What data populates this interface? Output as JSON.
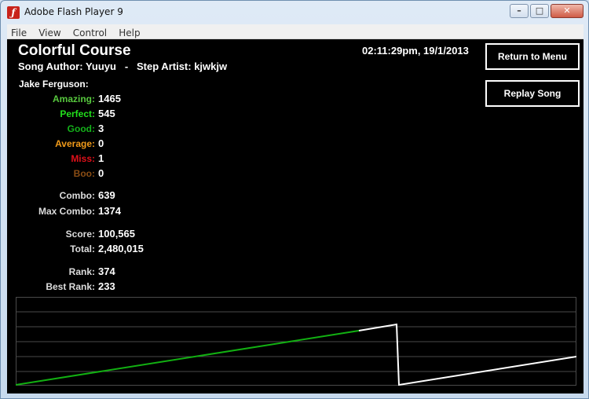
{
  "window": {
    "title": "Adobe Flash Player 9",
    "icon": "flash-player-icon"
  },
  "menu": [
    "File",
    "View",
    "Control",
    "Help"
  ],
  "header": {
    "song_title": "Colorful Course",
    "song_author_label": "Song Author:",
    "song_author": "Yuuyu",
    "separator": "-",
    "step_artist_label": "Step Artist:",
    "step_artist": "kjwkjw",
    "datetime": "02:11:29pm, 19/1/2013"
  },
  "buttons": {
    "return": "Return to Menu",
    "replay": "Replay Song"
  },
  "player": "Jake Ferguson:",
  "judgements": [
    {
      "label": "Amazing:",
      "value": "1465",
      "color": "#57c83e"
    },
    {
      "label": "Perfect:",
      "value": "545",
      "color": "#22e01c"
    },
    {
      "label": "Good:",
      "value": "3",
      "color": "#14b01a"
    },
    {
      "label": "Average:",
      "value": "0",
      "color": "#f09a1a"
    },
    {
      "label": "Miss:",
      "value": "1",
      "color": "#e0101a"
    },
    {
      "label": "Boo:",
      "value": "0",
      "color": "#8a4d14"
    }
  ],
  "combo": [
    {
      "label": "Combo:",
      "value": "639"
    },
    {
      "label": "Max Combo:",
      "value": "1374"
    }
  ],
  "score": [
    {
      "label": "Score:",
      "value": "100,565"
    },
    {
      "label": "Total:",
      "value": "2,480,015"
    }
  ],
  "rank": [
    {
      "label": "Rank:",
      "value": "374"
    },
    {
      "label": "Best Rank:",
      "value": "233"
    }
  ],
  "graph_colors": {
    "combo_ok": "#12b012",
    "combo_after": "#ffffff",
    "grid": "#4a4a4a"
  }
}
